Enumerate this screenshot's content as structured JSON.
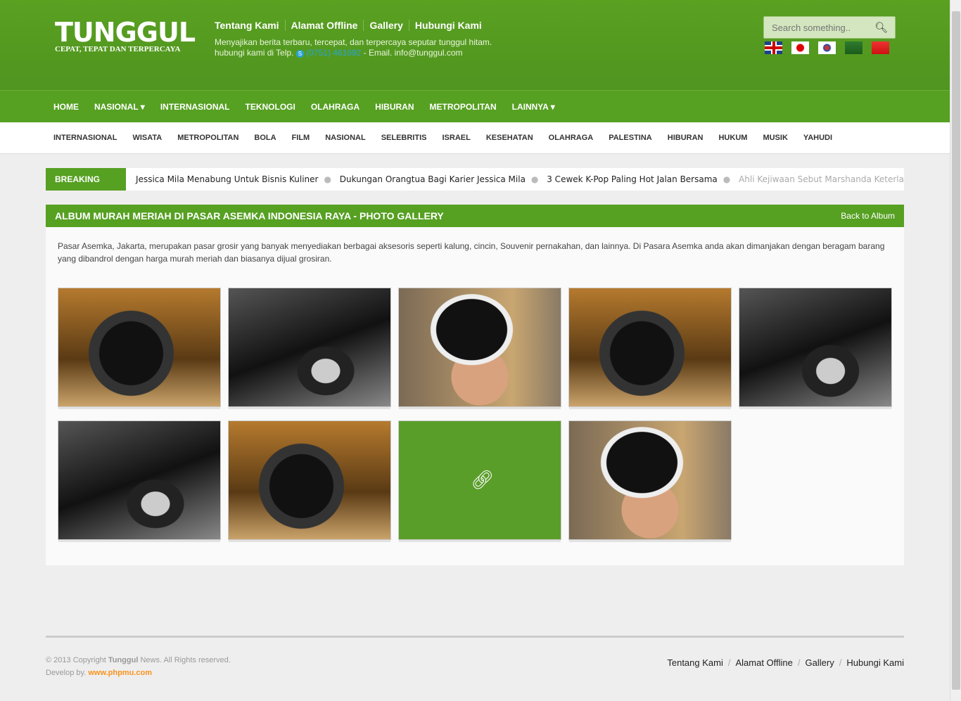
{
  "header": {
    "logo": "TUNGGUL",
    "tagline": "CEPAT, TEPAT DAN TERPERCAYA",
    "top_links": [
      "Tentang Kami",
      "Alamat Offline",
      "Gallery",
      "Hubungi Kami"
    ],
    "desc1": "Menyajikan berita terbaru, tercepat, dan terpercaya seputar tunggul hitam.",
    "desc2": "hubungi kami di Telp.",
    "phone": "(0751) 461692",
    "email": "- Email. info@tunggul.com",
    "search_placeholder": "Search something..",
    "flags": [
      "uk",
      "japan",
      "korea",
      "saudi-arabia",
      "china"
    ]
  },
  "nav": [
    "HOME",
    "NASIONAL ▾",
    "INTERNASIONAL",
    "TEKNOLOGI",
    "OLAHRAGA",
    "HIBURAN",
    "METROPOLITAN",
    "LAINNYA ▾"
  ],
  "subnav": [
    "INTERNASIONAL",
    "WISATA",
    "METROPOLITAN",
    "BOLA",
    "FILM",
    "NASIONAL",
    "SELEBRITIS",
    "ISRAEL",
    "KESEHATAN",
    "OLAHRAGA",
    "PALESTINA",
    "HIBURAN",
    "HUKUM",
    "MUSIK",
    "YAHUDI"
  ],
  "breaking": {
    "label": "BREAKING NEWS",
    "items": [
      "Jessica Mila Menabung Untuk Bisnis Kuliner",
      "Dukungan Orangtua Bagi Karier Jessica Mila",
      "3 Cewek K-Pop Paling Hot Jalan Bersama",
      "Ahli Kejiwaan Sebut Marshanda Keterla"
    ]
  },
  "album": {
    "title": "ALBUM MURAH MERIAH DI PASAR ASEMKA INDONESIA RAYA - PHOTO GALLERY",
    "back": "Back to Album",
    "description": "Pasar Asemka, Jakarta, merupakan pasar grosir yang banyak menyediakan berbagai aksesoris seperti kalung, cincin, Souvenir pernakahan, dan lainnya. Di Pasara Asemka anda akan dimanjakan dengan beragam barang yang dibandrol dengan harga murah meriah dan biasanya dijual grosiran.",
    "photos": [
      "camera",
      "car",
      "woman",
      "camera",
      "car",
      "car",
      "camera",
      "car-hovered",
      "woman"
    ]
  },
  "footer": {
    "copy_pre": "© 2013 Copyright ",
    "brand": "Tunggul",
    "copy_post": " News. All Rights reserved.",
    "dev": "Develop by. ",
    "dev_link": "www.phpmu.com",
    "links": [
      "Tentang Kami",
      "Alamat Offline",
      "Gallery",
      "Hubungi Kami"
    ]
  },
  "colors": {
    "brand_green": "#56a022",
    "accent_orange": "#f7941d"
  }
}
